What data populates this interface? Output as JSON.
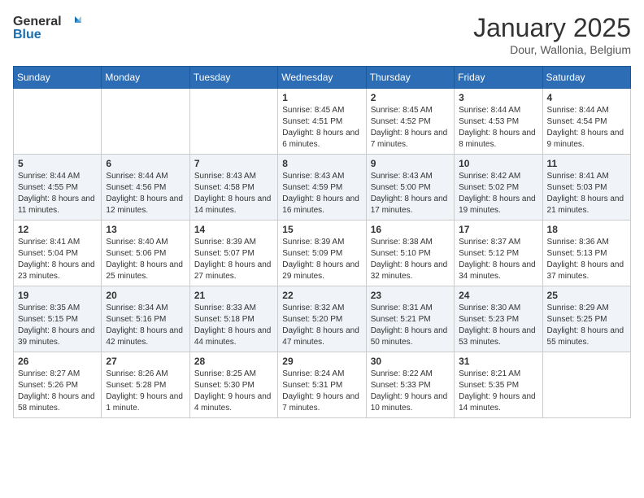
{
  "header": {
    "logo_general": "General",
    "logo_blue": "Blue",
    "month_title": "January 2025",
    "location": "Dour, Wallonia, Belgium"
  },
  "days_of_week": [
    "Sunday",
    "Monday",
    "Tuesday",
    "Wednesday",
    "Thursday",
    "Friday",
    "Saturday"
  ],
  "weeks": [
    [
      {
        "day": "",
        "info": ""
      },
      {
        "day": "",
        "info": ""
      },
      {
        "day": "",
        "info": ""
      },
      {
        "day": "1",
        "info": "Sunrise: 8:45 AM\nSunset: 4:51 PM\nDaylight: 8 hours and 6 minutes."
      },
      {
        "day": "2",
        "info": "Sunrise: 8:45 AM\nSunset: 4:52 PM\nDaylight: 8 hours and 7 minutes."
      },
      {
        "day": "3",
        "info": "Sunrise: 8:44 AM\nSunset: 4:53 PM\nDaylight: 8 hours and 8 minutes."
      },
      {
        "day": "4",
        "info": "Sunrise: 8:44 AM\nSunset: 4:54 PM\nDaylight: 8 hours and 9 minutes."
      }
    ],
    [
      {
        "day": "5",
        "info": "Sunrise: 8:44 AM\nSunset: 4:55 PM\nDaylight: 8 hours and 11 minutes."
      },
      {
        "day": "6",
        "info": "Sunrise: 8:44 AM\nSunset: 4:56 PM\nDaylight: 8 hours and 12 minutes."
      },
      {
        "day": "7",
        "info": "Sunrise: 8:43 AM\nSunset: 4:58 PM\nDaylight: 8 hours and 14 minutes."
      },
      {
        "day": "8",
        "info": "Sunrise: 8:43 AM\nSunset: 4:59 PM\nDaylight: 8 hours and 16 minutes."
      },
      {
        "day": "9",
        "info": "Sunrise: 8:43 AM\nSunset: 5:00 PM\nDaylight: 8 hours and 17 minutes."
      },
      {
        "day": "10",
        "info": "Sunrise: 8:42 AM\nSunset: 5:02 PM\nDaylight: 8 hours and 19 minutes."
      },
      {
        "day": "11",
        "info": "Sunrise: 8:41 AM\nSunset: 5:03 PM\nDaylight: 8 hours and 21 minutes."
      }
    ],
    [
      {
        "day": "12",
        "info": "Sunrise: 8:41 AM\nSunset: 5:04 PM\nDaylight: 8 hours and 23 minutes."
      },
      {
        "day": "13",
        "info": "Sunrise: 8:40 AM\nSunset: 5:06 PM\nDaylight: 8 hours and 25 minutes."
      },
      {
        "day": "14",
        "info": "Sunrise: 8:39 AM\nSunset: 5:07 PM\nDaylight: 8 hours and 27 minutes."
      },
      {
        "day": "15",
        "info": "Sunrise: 8:39 AM\nSunset: 5:09 PM\nDaylight: 8 hours and 29 minutes."
      },
      {
        "day": "16",
        "info": "Sunrise: 8:38 AM\nSunset: 5:10 PM\nDaylight: 8 hours and 32 minutes."
      },
      {
        "day": "17",
        "info": "Sunrise: 8:37 AM\nSunset: 5:12 PM\nDaylight: 8 hours and 34 minutes."
      },
      {
        "day": "18",
        "info": "Sunrise: 8:36 AM\nSunset: 5:13 PM\nDaylight: 8 hours and 37 minutes."
      }
    ],
    [
      {
        "day": "19",
        "info": "Sunrise: 8:35 AM\nSunset: 5:15 PM\nDaylight: 8 hours and 39 minutes."
      },
      {
        "day": "20",
        "info": "Sunrise: 8:34 AM\nSunset: 5:16 PM\nDaylight: 8 hours and 42 minutes."
      },
      {
        "day": "21",
        "info": "Sunrise: 8:33 AM\nSunset: 5:18 PM\nDaylight: 8 hours and 44 minutes."
      },
      {
        "day": "22",
        "info": "Sunrise: 8:32 AM\nSunset: 5:20 PM\nDaylight: 8 hours and 47 minutes."
      },
      {
        "day": "23",
        "info": "Sunrise: 8:31 AM\nSunset: 5:21 PM\nDaylight: 8 hours and 50 minutes."
      },
      {
        "day": "24",
        "info": "Sunrise: 8:30 AM\nSunset: 5:23 PM\nDaylight: 8 hours and 53 minutes."
      },
      {
        "day": "25",
        "info": "Sunrise: 8:29 AM\nSunset: 5:25 PM\nDaylight: 8 hours and 55 minutes."
      }
    ],
    [
      {
        "day": "26",
        "info": "Sunrise: 8:27 AM\nSunset: 5:26 PM\nDaylight: 8 hours and 58 minutes."
      },
      {
        "day": "27",
        "info": "Sunrise: 8:26 AM\nSunset: 5:28 PM\nDaylight: 9 hours and 1 minute."
      },
      {
        "day": "28",
        "info": "Sunrise: 8:25 AM\nSunset: 5:30 PM\nDaylight: 9 hours and 4 minutes."
      },
      {
        "day": "29",
        "info": "Sunrise: 8:24 AM\nSunset: 5:31 PM\nDaylight: 9 hours and 7 minutes."
      },
      {
        "day": "30",
        "info": "Sunrise: 8:22 AM\nSunset: 5:33 PM\nDaylight: 9 hours and 10 minutes."
      },
      {
        "day": "31",
        "info": "Sunrise: 8:21 AM\nSunset: 5:35 PM\nDaylight: 9 hours and 14 minutes."
      },
      {
        "day": "",
        "info": ""
      }
    ]
  ]
}
